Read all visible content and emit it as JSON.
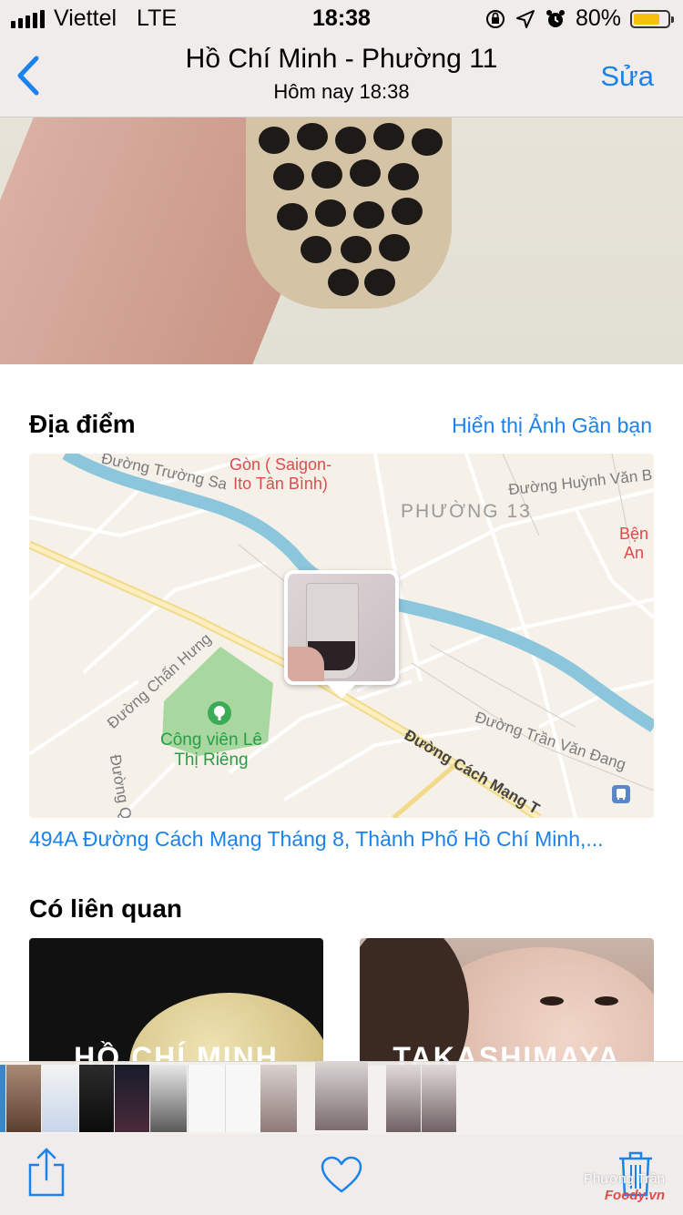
{
  "status_bar": {
    "carrier": "Viettel",
    "network": "LTE",
    "time": "18:38",
    "battery": "80%",
    "battery_level": 0.8
  },
  "nav": {
    "title": "Hồ Chí Minh - Phường 11",
    "subtitle": "Hôm nay  18:38",
    "edit_label": "Sửa"
  },
  "location": {
    "heading": "Địa điểm",
    "nearby_link": "Hiển thị Ảnh Gần bạn",
    "address": "494A Đường Cách Mạng Tháng 8, Thành Phố Hồ Chí Minh,...",
    "map": {
      "district": "PHƯỜNG 13",
      "poi_line1": "Gòn ( Saigon-",
      "poi_line2": "Ito Tân Bình)",
      "poi_right1": "Bện",
      "poi_right2": "An",
      "park_line1": "Công viên Lê",
      "park_line2": "Thị Riêng",
      "streets": {
        "truong_sa": "Đường Trường Sa",
        "huynh_van": "Đường Huỳnh Văn B",
        "chan_hung": "Đường Chấn Hưng",
        "tran_van_dang": "Đường Trần Văn Đang",
        "cach_mang": "Đường Cách Mạng T",
        "left_bottom": "Đường Q"
      }
    }
  },
  "related": {
    "heading": "Có liên quan",
    "cards": [
      {
        "title": "HỒ CHÍ MINH"
      },
      {
        "title": "TAKASHIMAYA"
      }
    ]
  },
  "watermark": {
    "line1": "Phương Trần",
    "line2": "Foody.vn"
  },
  "colors": {
    "accent": "#1a82ea",
    "bar_bg": "#efeceb",
    "map_bg": "#f5f1e9",
    "park": "#a9d7a0",
    "river": "#8cc6dc"
  },
  "icons": [
    "back-chevron-icon",
    "share-icon",
    "heart-icon",
    "trash-icon",
    "park-tree-icon",
    "bus-stop-icon"
  ]
}
